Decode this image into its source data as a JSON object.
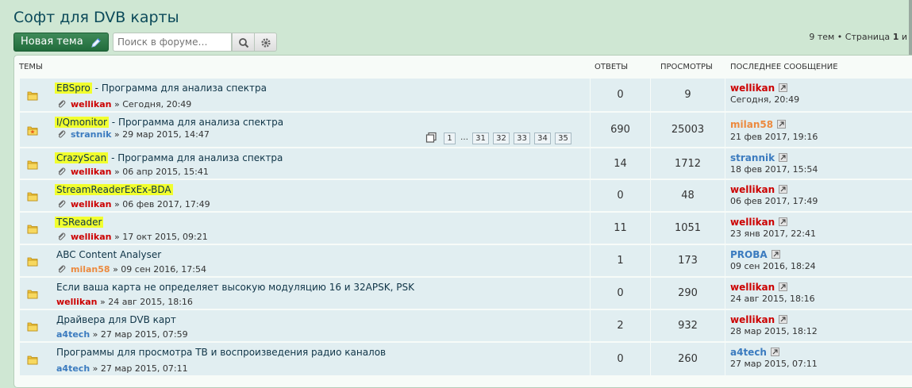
{
  "page": {
    "title": "Софт для DVB карты"
  },
  "actions": {
    "new_topic_label": "Новая тема",
    "search_placeholder": "Поиск в форуме…"
  },
  "pagination": {
    "summary_prefix": "9 тем • Страница",
    "current_page": "1",
    "summary_cut": "и"
  },
  "columns": {
    "topics": "ТЕМЫ",
    "replies": "ОТВЕТЫ",
    "views": "ПРОСМОТРЫ",
    "last_post": "ПОСЛЕДНЕЕ СООБЩЕНИЕ"
  },
  "topic_pages": [
    "1",
    "…",
    "31",
    "32",
    "33",
    "34",
    "35"
  ],
  "topics": [
    {
      "title_highlight": "EBSpro",
      "title_rest": " - Программа для анализа спектра",
      "attachment": true,
      "author": "wellikan",
      "author_color": "#cc0000",
      "time": "» Сегодня, 20:49",
      "replies": "0",
      "views": "9",
      "last_author": "wellikan",
      "last_author_color": "#cc0000",
      "last_time": "Сегодня, 20:49",
      "folder_state": "read"
    },
    {
      "title_highlight": "I/Qmonitor",
      "title_rest": " - Программа для анализа спектра",
      "attachment": true,
      "author": "strannik",
      "author_color": "#3b7bbf",
      "time": "» 29 мар 2015, 14:47",
      "replies": "690",
      "views": "25003",
      "last_author": "milan58",
      "last_author_color": "#ec8a3f",
      "last_time": "21 фев 2017, 19:16",
      "folder_state": "hot"
    },
    {
      "title_highlight": "CrazyScan",
      "title_rest": " - Программа для анализа спектра",
      "attachment": true,
      "author": "wellikan",
      "author_color": "#cc0000",
      "time": "» 06 апр 2015, 15:41",
      "replies": "14",
      "views": "1712",
      "last_author": "strannik",
      "last_author_color": "#3b7bbf",
      "last_time": "18 фев 2017, 15:54",
      "folder_state": "read"
    },
    {
      "title_highlight": "StreamReaderExEx-BDA",
      "title_rest": "",
      "attachment": true,
      "author": "wellikan",
      "author_color": "#cc0000",
      "time": "» 06 фев 2017, 17:49",
      "replies": "0",
      "views": "48",
      "last_author": "wellikan",
      "last_author_color": "#cc0000",
      "last_time": "06 фев 2017, 17:49",
      "folder_state": "read"
    },
    {
      "title_highlight": "TSReader",
      "title_rest": "",
      "attachment": true,
      "author": "wellikan",
      "author_color": "#cc0000",
      "time": "» 17 окт 2015, 09:21",
      "replies": "11",
      "views": "1051",
      "last_author": "wellikan",
      "last_author_color": "#cc0000",
      "last_time": "23 янв 2017, 22:41",
      "folder_state": "read"
    },
    {
      "title_highlight": "",
      "title_rest": "ABC Content Analyser",
      "attachment": true,
      "author": "milan58",
      "author_color": "#ec8a3f",
      "time": "» 09 сен 2016, 17:54",
      "replies": "1",
      "views": "173",
      "last_author": "PROBA",
      "last_author_color": "#3b7bbf",
      "last_time": "09 сен 2016, 18:24",
      "folder_state": "read"
    },
    {
      "title_highlight": "",
      "title_rest": "Если ваша карта не определяет высокую модуляцию 16 и 32APSK, PSK",
      "attachment": false,
      "author": "wellikan",
      "author_color": "#cc0000",
      "time": "» 24 авг 2015, 18:16",
      "replies": "0",
      "views": "290",
      "last_author": "wellikan",
      "last_author_color": "#cc0000",
      "last_time": "24 авг 2015, 18:16",
      "folder_state": "read"
    },
    {
      "title_highlight": "",
      "title_rest": "Драйвера для DVB карт",
      "attachment": false,
      "author": "a4tech",
      "author_color": "#3b7bbf",
      "time": "» 27 мар 2015, 07:59",
      "replies": "2",
      "views": "932",
      "last_author": "wellikan",
      "last_author_color": "#cc0000",
      "last_time": "28 мар 2015, 18:12",
      "folder_state": "read"
    },
    {
      "title_highlight": "",
      "title_rest": "Программы для просмотра ТВ и воспроизведения радио каналов",
      "attachment": false,
      "author": "a4tech",
      "author_color": "#3b7bbf",
      "time": "» 27 мар 2015, 07:11",
      "replies": "0",
      "views": "260",
      "last_author": "a4tech",
      "last_author_color": "#3b7bbf",
      "last_time": "27 мар 2015, 07:11",
      "folder_state": "read"
    }
  ]
}
